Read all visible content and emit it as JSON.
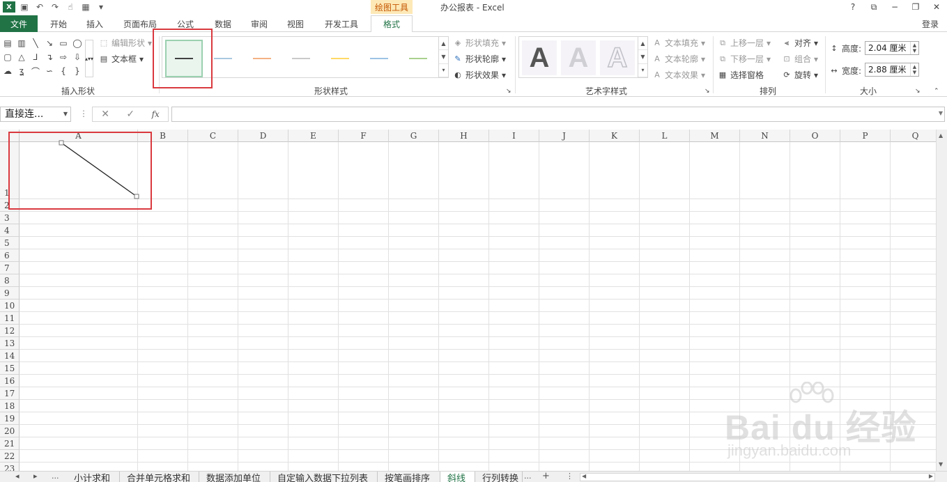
{
  "window": {
    "doc_title": "办公报表 - Excel",
    "contextual_group": "绘图工具",
    "sign_in": "登录",
    "controls": [
      "?",
      "⧉",
      "−",
      "❐",
      "✕"
    ]
  },
  "tabs": [
    "文件",
    "开始",
    "插入",
    "页面布局",
    "公式",
    "数据",
    "审阅",
    "视图",
    "开发工具",
    "格式"
  ],
  "ribbon": {
    "insert_shapes": {
      "label": "插入形状",
      "edit_shape": "编辑形状",
      "text_box": "文本框"
    },
    "shape_styles": {
      "label": "形状样式",
      "fill": "形状填充",
      "outline": "形状轮廓",
      "effects": "形状效果",
      "line_colors": [
        "#404040",
        "#a9c8e0",
        "#f4b183",
        "#c9c9c9",
        "#ffd966",
        "#9dc3e6",
        "#a9d18e"
      ]
    },
    "wordart": {
      "label": "艺术字样式",
      "glyph": "A",
      "text_fill": "文本填充",
      "text_outline": "文本轮廓",
      "text_effects": "文本效果"
    },
    "arrange": {
      "label": "排列",
      "bring_forward": "上移一层",
      "send_backward": "下移一层",
      "selection_pane": "选择窗格",
      "align": "对齐",
      "group": "组合",
      "rotate": "旋转"
    },
    "size": {
      "label": "大小",
      "height_label": "高度:",
      "height_value": "2.04 厘米",
      "width_label": "宽度:",
      "width_value": "2.88 厘米"
    }
  },
  "formula_bar": {
    "name_box": "直接连...",
    "cancel": "✕",
    "enter": "✓",
    "fx": "fx",
    "value": ""
  },
  "grid": {
    "columns": [
      "A",
      "B",
      "C",
      "D",
      "E",
      "F",
      "G",
      "H",
      "I",
      "J",
      "K",
      "L",
      "M",
      "N",
      "O",
      "P",
      "Q"
    ],
    "rows": [
      "1",
      "2",
      "3",
      "4",
      "5",
      "6",
      "7",
      "8",
      "9",
      "10",
      "11",
      "12",
      "13",
      "14",
      "15",
      "16",
      "17",
      "18",
      "19",
      "20",
      "21",
      "22",
      "23"
    ]
  },
  "sheets": {
    "tabs": [
      "小计求和",
      "合并单元格求和",
      "数据添加单位",
      "自定输入数据下拉列表",
      "按笔画排序",
      "斜线",
      "行列转换"
    ],
    "active": "斜线",
    "more": "...",
    "add": "+"
  },
  "watermark": {
    "brand": "Bai du 经验",
    "url": "jingyan.baidu.com"
  }
}
